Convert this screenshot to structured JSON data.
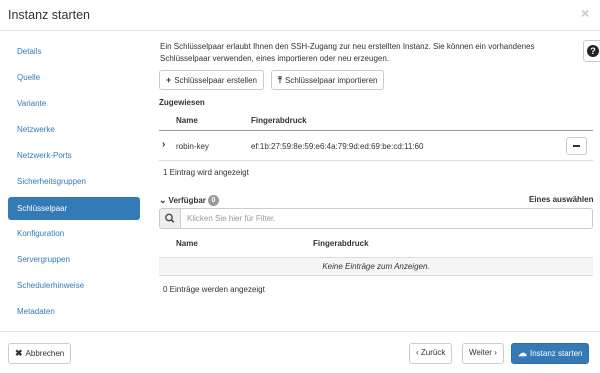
{
  "modal": {
    "title": "Instanz starten",
    "close_glyph": "×"
  },
  "sidebar": {
    "items": [
      {
        "label": "Details"
      },
      {
        "label": "Quelle"
      },
      {
        "label": "Variante"
      },
      {
        "label": "Netzwerke"
      },
      {
        "label": "Netzwerk-Ports"
      },
      {
        "label": "Sicherheitsgruppen"
      },
      {
        "label": "Schlüsselpaar",
        "active": true
      },
      {
        "label": "Konfiguration"
      },
      {
        "label": "Servergruppen"
      },
      {
        "label": "Schedulerhinweise"
      },
      {
        "label": "Metadaten"
      }
    ]
  },
  "help": {
    "glyph": "?"
  },
  "main": {
    "intro": "Ein Schlüsselpaar erlaubt Ihnen den SSH-Zugang zur neu erstellten Instanz. Sie können ein vorhandenes Schlüsselpaar verwenden, eines importieren oder neu erzeugen.",
    "create_label": "Schlüsselpaar erstellen",
    "import_label": "Schlüsselpaar importieren",
    "allocated": {
      "label": "Zugewiesen",
      "col_name": "Name",
      "col_fingerprint": "Fingerabdruck",
      "rows": [
        {
          "name": "robin-key",
          "fingerprint": "ef:1b:27:59:8e:59:e6:4a:79:9d:ed:69:be:cd:11:60"
        }
      ],
      "count_text": "1 Eintrag wird angezeigt"
    },
    "available": {
      "label": "Verfügbar",
      "badge": "0",
      "select_one": "Eines auswählen",
      "filter_placeholder": "Klicken Sie hier für Filter.",
      "col_name": "Name",
      "col_fingerprint": "Fingerabdruck",
      "empty_text": "Keine Einträge zum Anzeigen.",
      "count_text": "0 Einträge werden angezeigt"
    }
  },
  "footer": {
    "cancel_label": "Abbrechen",
    "back_label": "‹ Zurück",
    "next_label": "Weiter ›",
    "launch_label": "Instanz starten"
  },
  "colors": {
    "primary": "#337ab7",
    "link": "#337ab7",
    "muted": "#999999"
  },
  "icons": [
    "close-icon",
    "help-icon",
    "plus-icon",
    "upload-icon",
    "chevron-right-icon",
    "minus-icon",
    "chevron-down-icon",
    "search-icon",
    "times-icon",
    "cloud-upload-icon"
  ]
}
